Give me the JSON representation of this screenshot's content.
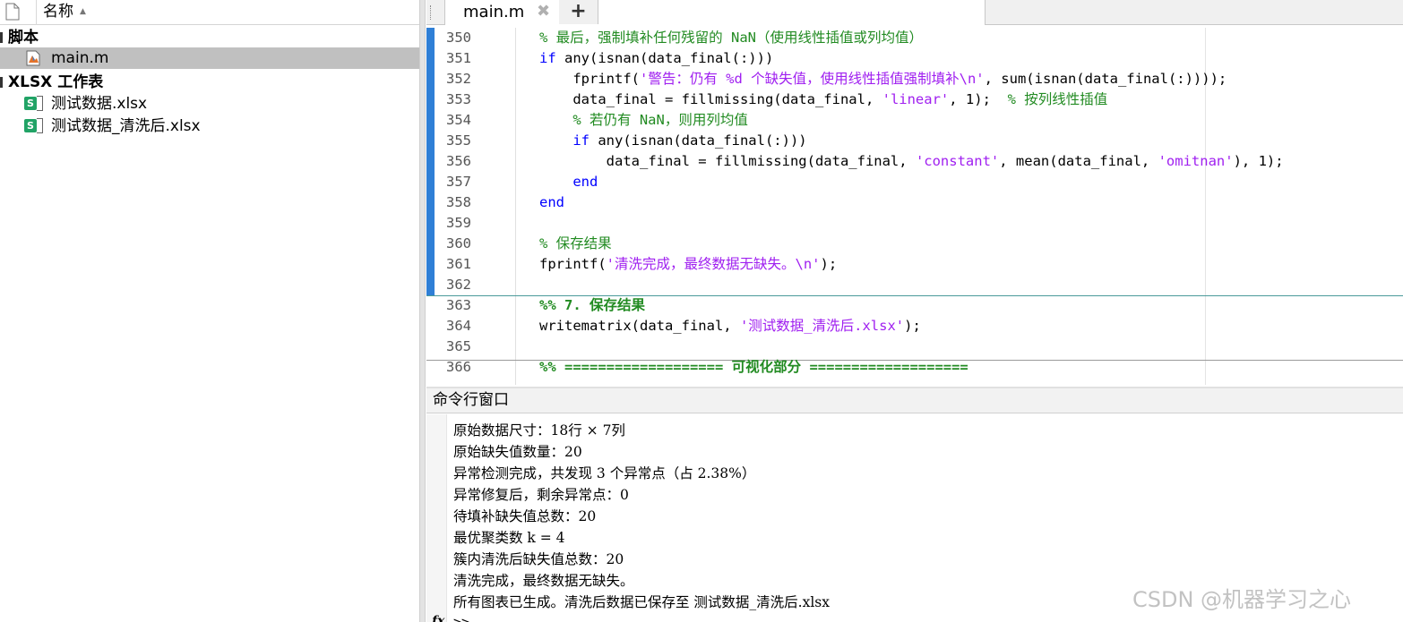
{
  "file_browser": {
    "column_name": "名称",
    "groups": [
      {
        "label": "脚本",
        "files": [
          {
            "name": "main.m",
            "type": "matlab-script",
            "selected": true
          }
        ]
      },
      {
        "label": "XLSX 工作表",
        "files": [
          {
            "name": "测试数据.xlsx",
            "type": "excel-sheet",
            "selected": false
          },
          {
            "name": "测试数据_清洗后.xlsx",
            "type": "excel-sheet",
            "selected": false
          }
        ]
      }
    ],
    "excel_badge": "S"
  },
  "editor": {
    "tabs": [
      {
        "label": "main.m",
        "close_glyph": "✖"
      }
    ],
    "add_tab_glyph": "+",
    "lines": [
      {
        "n": "350",
        "indent": "",
        "tokens": [
          {
            "t": "% 最后，强制填补任何残留的 NaN（使用线性插值或列均值）",
            "c": "cm"
          }
        ]
      },
      {
        "n": "351",
        "indent": "",
        "tokens": [
          {
            "t": "if",
            "c": "kw"
          },
          {
            "t": " any(isnan(data_final(:)))",
            "c": ""
          }
        ]
      },
      {
        "n": "352",
        "indent": "    ",
        "tokens": [
          {
            "t": "fprintf(",
            "c": ""
          },
          {
            "t": "'警告：仍有 %d 个缺失值，使用线性插值强制填补\\n'",
            "c": "str"
          },
          {
            "t": ", sum(isnan(data_final(:))));",
            "c": ""
          }
        ]
      },
      {
        "n": "353",
        "indent": "    ",
        "tokens": [
          {
            "t": "data_final = fillmissing(data_final, ",
            "c": ""
          },
          {
            "t": "'linear'",
            "c": "str"
          },
          {
            "t": ", 1);  ",
            "c": ""
          },
          {
            "t": "% 按列线性插值",
            "c": "cm"
          }
        ]
      },
      {
        "n": "354",
        "indent": "    ",
        "tokens": [
          {
            "t": "% 若仍有 NaN，则用列均值",
            "c": "cm"
          }
        ]
      },
      {
        "n": "355",
        "indent": "    ",
        "tokens": [
          {
            "t": "if",
            "c": "kw"
          },
          {
            "t": " any(isnan(data_final(:)))",
            "c": ""
          }
        ]
      },
      {
        "n": "356",
        "indent": "        ",
        "tokens": [
          {
            "t": "data_final = fillmissing(data_final, ",
            "c": ""
          },
          {
            "t": "'constant'",
            "c": "str"
          },
          {
            "t": ", mean(data_final, ",
            "c": ""
          },
          {
            "t": "'omitnan'",
            "c": "str"
          },
          {
            "t": "), 1);",
            "c": ""
          }
        ]
      },
      {
        "n": "357",
        "indent": "    ",
        "tokens": [
          {
            "t": "end",
            "c": "kw"
          }
        ]
      },
      {
        "n": "358",
        "indent": "",
        "tokens": [
          {
            "t": "end",
            "c": "kw"
          }
        ]
      },
      {
        "n": "359",
        "indent": "",
        "tokens": []
      },
      {
        "n": "360",
        "indent": "",
        "tokens": [
          {
            "t": "% 保存结果",
            "c": "cm"
          }
        ]
      },
      {
        "n": "361",
        "indent": "",
        "tokens": [
          {
            "t": "fprintf(",
            "c": ""
          },
          {
            "t": "'清洗完成，最终数据无缺失。\\n'",
            "c": "str"
          },
          {
            "t": ");",
            "c": ""
          }
        ]
      },
      {
        "n": "362",
        "indent": "",
        "tokens": []
      },
      {
        "n": "363",
        "indent": "",
        "tokens": [
          {
            "t": "%% 7. 保存结果",
            "c": "cell"
          }
        ]
      },
      {
        "n": "364",
        "indent": "",
        "tokens": [
          {
            "t": "writematrix(data_final, ",
            "c": ""
          },
          {
            "t": "'测试数据_清洗后.xlsx'",
            "c": "str"
          },
          {
            "t": ");",
            "c": ""
          }
        ]
      },
      {
        "n": "365",
        "indent": "",
        "tokens": []
      },
      {
        "n": "366",
        "indent": "",
        "tokens": [
          {
            "t": "%% =================== 可视化部分 ===================",
            "c": "cell"
          }
        ]
      }
    ]
  },
  "command_window": {
    "title": "命令行窗口",
    "output": [
      "原始数据尺寸：18行 × 7列",
      "原始缺失值数量：20",
      "异常检测完成，共发现 3 个异常点（占 2.38%）",
      "异常修复后，剩余异常点：0",
      "待填补缺失值总数：20",
      "最优聚类数 k = 4",
      "簇内清洗后缺失值总数：20",
      "清洗完成，最终数据无缺失。",
      "所有图表已生成。清洗后数据已保存至 测试数据_清洗后.xlsx"
    ],
    "fx_label": "fx",
    "prompt": ">>"
  },
  "watermark": "CSDN @机器学习之心",
  "colors": {
    "keyword": "#0000ff",
    "string": "#a020f0",
    "comment": "#228b22",
    "cell_bar": "#2f7fd6",
    "selection": "#c0c0c0",
    "excel_green": "#21a366"
  }
}
